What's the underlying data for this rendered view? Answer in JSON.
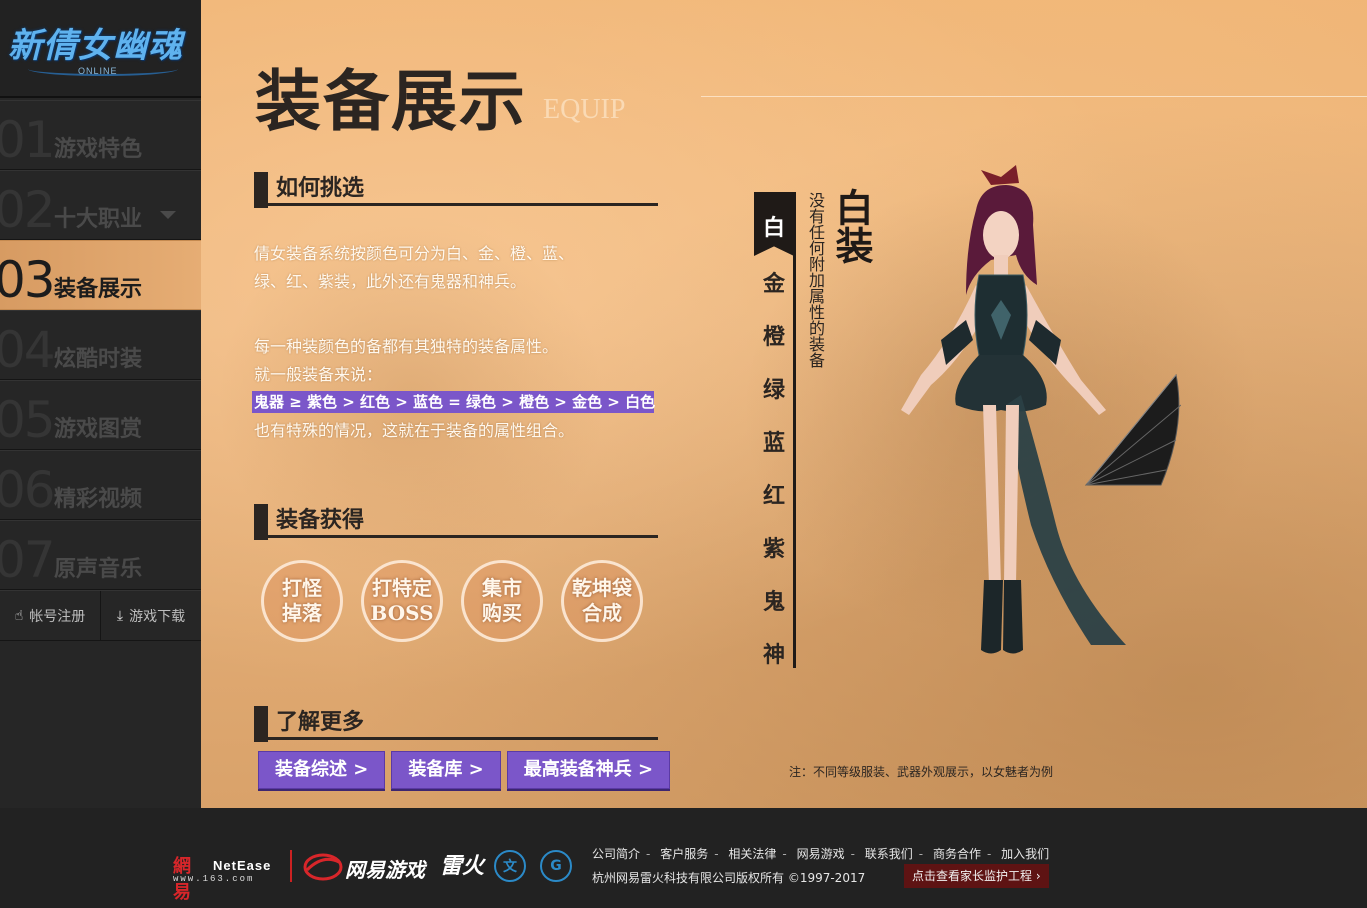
{
  "logo": {
    "text": "新倩女幽魂",
    "sub": "ONLINE"
  },
  "nav": {
    "items": [
      {
        "num": "01",
        "label": "游戏特色"
      },
      {
        "num": "02",
        "label": "十大职业"
      },
      {
        "num": "03",
        "label": "装备展示"
      },
      {
        "num": "04",
        "label": "炫酷时装"
      },
      {
        "num": "05",
        "label": "游戏图赏"
      },
      {
        "num": "06",
        "label": "精彩视频"
      },
      {
        "num": "07",
        "label": "原声音乐"
      }
    ],
    "register": "帐号注册",
    "download": "游戏下载"
  },
  "page": {
    "title": "装备展示",
    "title_en": "EQUIP"
  },
  "how": {
    "heading": "如何挑选",
    "line1": "倩女装备系统按颜色可分为白、金、橙、蓝、",
    "line2": "绿、红、紫装，此外还有鬼器和神兵。",
    "line3": "每一种装颜色的备都有其独特的装备属性。",
    "line4": "就一般装备来说：",
    "rank": "鬼器 ≥ 紫色 > 红色 > 蓝色 = 绿色 > 橙色 > 金色 > 白色",
    "line5": "也有特殊的情况，这就在于装备的属性组合。"
  },
  "obtain": {
    "heading": "装备获得",
    "circles": [
      {
        "l1": "打怪",
        "l2": "掉落"
      },
      {
        "l1": "打特定",
        "l2": "BOSS"
      },
      {
        "l1": "集市",
        "l2": "购买"
      },
      {
        "l1": "乾坤袋",
        "l2": "合成"
      }
    ]
  },
  "more": {
    "heading": "了解更多",
    "buttons": [
      "装备综述 >",
      "装备库 >",
      "最高装备神兵 >"
    ]
  },
  "quality": {
    "active": "白",
    "items": [
      "金",
      "橙",
      "绿",
      "蓝",
      "红",
      "紫",
      "鬼",
      "神"
    ],
    "title": "白装",
    "desc": "没有任何附加属性的装备"
  },
  "note": "注：不同等级服装、武器外观展示，以女魅者为例",
  "footer": {
    "netease_cn": "網易",
    "netease_en": "NetEase",
    "netease_url": "www.163.com",
    "nie": "网易游戏",
    "leihuo": "雷火",
    "logo2": "文",
    "logo3": "G",
    "links": [
      "公司简介",
      "客户服务",
      "相关法律",
      "网易游戏",
      "联系我们",
      "商务合作",
      "加入我们"
    ],
    "copyright": "杭州网易雷火科技有限公司版权所有 ©1997-2017",
    "parent": "点击查看家长监护工程 ›"
  }
}
